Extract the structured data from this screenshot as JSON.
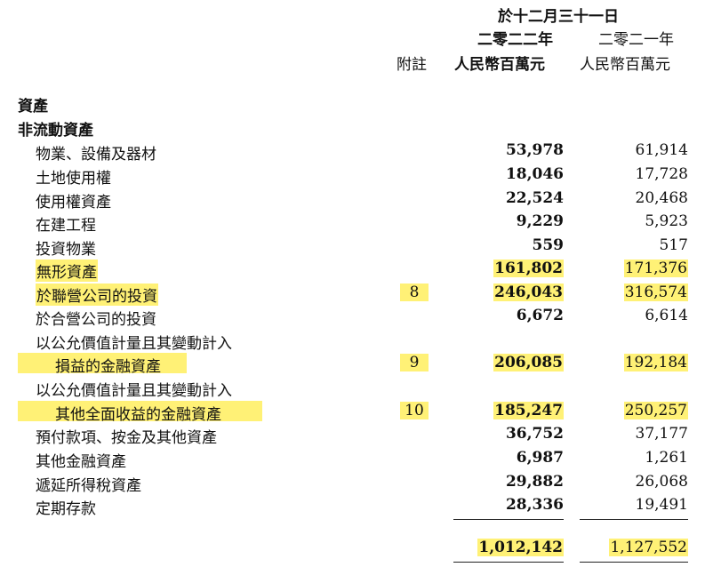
{
  "header": {
    "period": "於十二月三十一日",
    "col_2022": "二零二二年",
    "col_2021": "二零二一年",
    "note_label": "附註",
    "unit_2022": "人民幣百萬元",
    "unit_2021": "人民幣百萬元"
  },
  "sections": {
    "assets": "資產",
    "non_current": "非流動資產"
  },
  "rows": [
    {
      "label": "物業、設備及器材",
      "note": "",
      "v2022": "53,978",
      "v2021": "61,914"
    },
    {
      "label": "土地使用權",
      "note": "",
      "v2022": "18,046",
      "v2021": "17,728"
    },
    {
      "label": "使用權資產",
      "note": "",
      "v2022": "22,524",
      "v2021": "20,468"
    },
    {
      "label": "在建工程",
      "note": "",
      "v2022": "9,229",
      "v2021": "5,923"
    },
    {
      "label": "投資物業",
      "note": "",
      "v2022": "559",
      "v2021": "517"
    },
    {
      "label": "無形資產",
      "note": "",
      "v2022": "161,802",
      "v2021": "171,376"
    },
    {
      "label": "於聯營公司的投資",
      "note": "8",
      "v2022": "246,043",
      "v2021": "316,574"
    },
    {
      "label": "於合營公司的投資",
      "note": "",
      "v2022": "6,672",
      "v2021": "6,614"
    },
    {
      "label": "以公允價值計量且其變動計入",
      "note": "",
      "v2022": "",
      "v2021": ""
    },
    {
      "label": "損益的金融資產",
      "note": "9",
      "v2022": "206,085",
      "v2021": "192,184"
    },
    {
      "label": "以公允價值計量且其變動計入",
      "note": "",
      "v2022": "",
      "v2021": ""
    },
    {
      "label": "其他全面收益的金融資產",
      "note": "10",
      "v2022": "185,247",
      "v2021": "250,257"
    },
    {
      "label": "預付款項、按金及其他資產",
      "note": "",
      "v2022": "36,752",
      "v2021": "37,177"
    },
    {
      "label": "其他金融資產",
      "note": "",
      "v2022": "6,987",
      "v2021": "1,261"
    },
    {
      "label": "遞延所得稅資產",
      "note": "",
      "v2022": "29,882",
      "v2021": "26,068"
    },
    {
      "label": "定期存款",
      "note": "",
      "v2022": "28,336",
      "v2021": "19,491"
    }
  ],
  "total": {
    "v2022": "1,012,142",
    "v2021": "1,127,552"
  },
  "colors": {
    "highlight": "#fff176",
    "text": "#111111"
  }
}
